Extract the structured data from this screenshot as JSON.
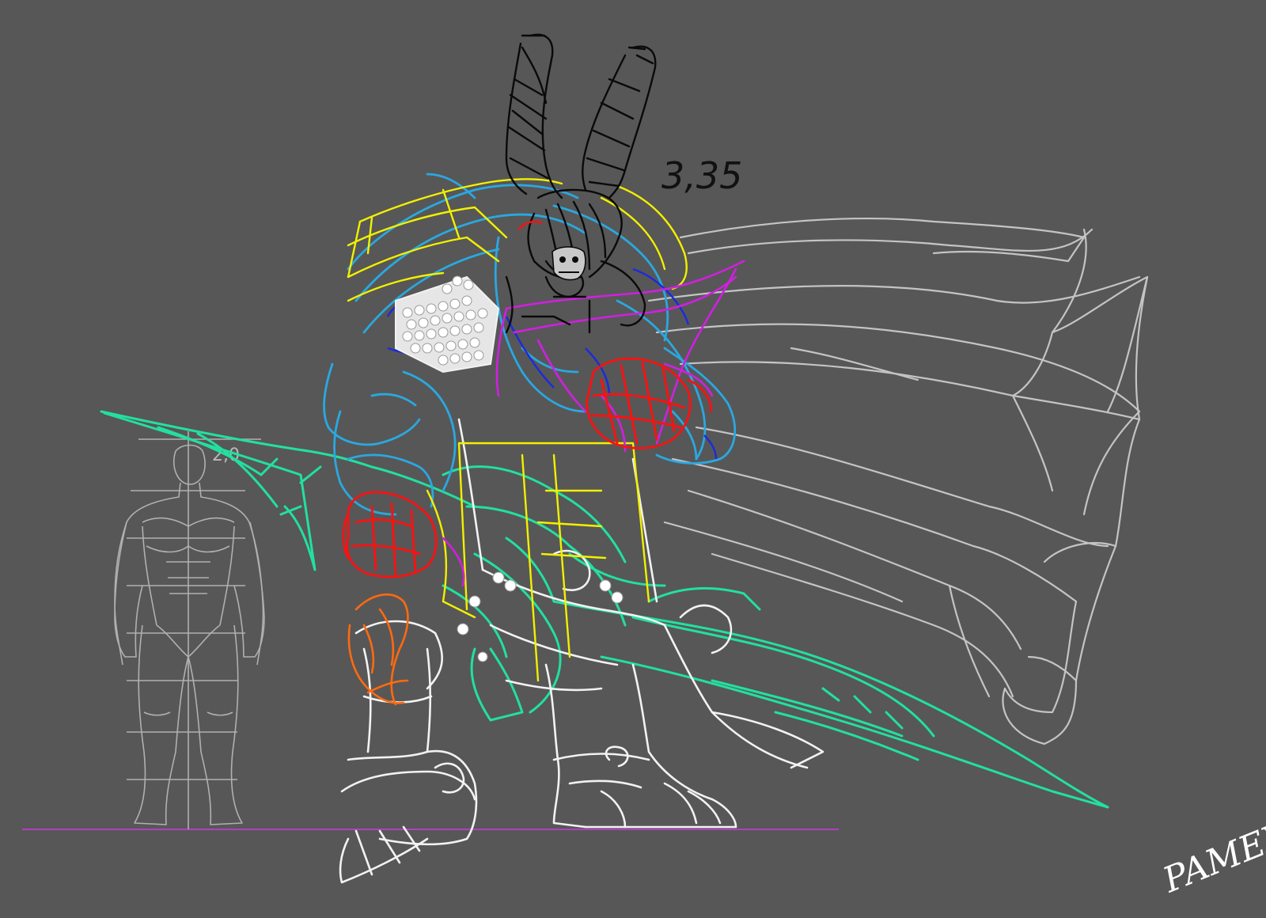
{
  "canvas": {
    "background": "#575757"
  },
  "annotations": {
    "monster_height": "3,35",
    "human_height": "2,0"
  },
  "signature": {
    "text": "PAMEX",
    "color": "#ffffff"
  },
  "colors": {
    "cape": "#c4c4c4",
    "armor_white": "#f2f2f2",
    "blade_green": "#22e0a0",
    "shoulder_yellow": "#f2f000",
    "arm_blue": "#2aa8e0",
    "deep_blue": "#1a2ae0",
    "magenta": "#d020e0",
    "fist_red": "#ff1010",
    "knee_orange": "#ff6a10",
    "horns_black": "#0a0a0a",
    "ground_line": "#b040c0",
    "human_ref": "#b0b0b0"
  }
}
